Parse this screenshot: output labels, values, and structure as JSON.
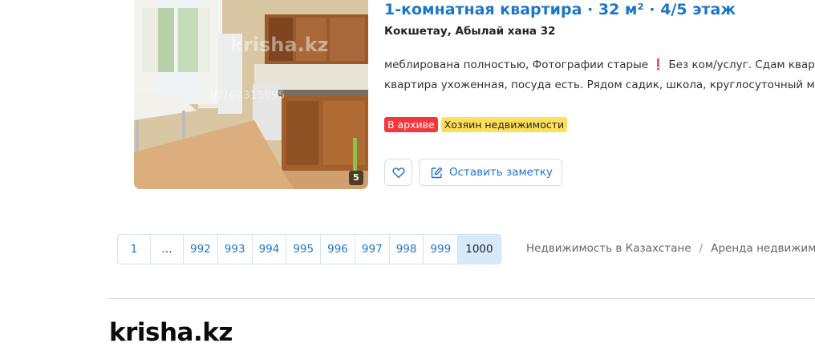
{
  "listing": {
    "photo_count": "5",
    "photo_watermark_logo": "krisha.kz",
    "photo_watermark_id": "ID762315895",
    "title": "1-комнатная квартира · 32 м² · 4/5 этаж",
    "address": "Кокшетау, Абылай хана 32",
    "description_line1": "меблирована полностью, Фотографии старые ❗ Без ком/услуг. Сдам квартиру",
    "description_line2": "квартира ухоженная, посуда есть. Рядом садик, школа, круглосуточный магази",
    "badges": {
      "archive": "В архиве",
      "owner": "Хозяин недвижимости"
    },
    "actions": {
      "favorite_icon": "heart-icon",
      "note_icon": "edit-note-icon",
      "note_label": "Оставить заметку"
    }
  },
  "pagination": {
    "pages": [
      "1",
      "…",
      "992",
      "993",
      "994",
      "995",
      "996",
      "997",
      "998",
      "999",
      "1000"
    ],
    "current": "1000"
  },
  "breadcrumb": {
    "item1": "Недвижимость в Казахстане",
    "separator": "/",
    "item2": "Аренда недвижимост"
  },
  "footer": {
    "logo": "krisha.kz"
  },
  "colors": {
    "link_blue": "#1c76c8",
    "archive_red": "#f2373d",
    "owner_yellow": "#fde05a",
    "current_page_bg": "#d8e9fa"
  }
}
